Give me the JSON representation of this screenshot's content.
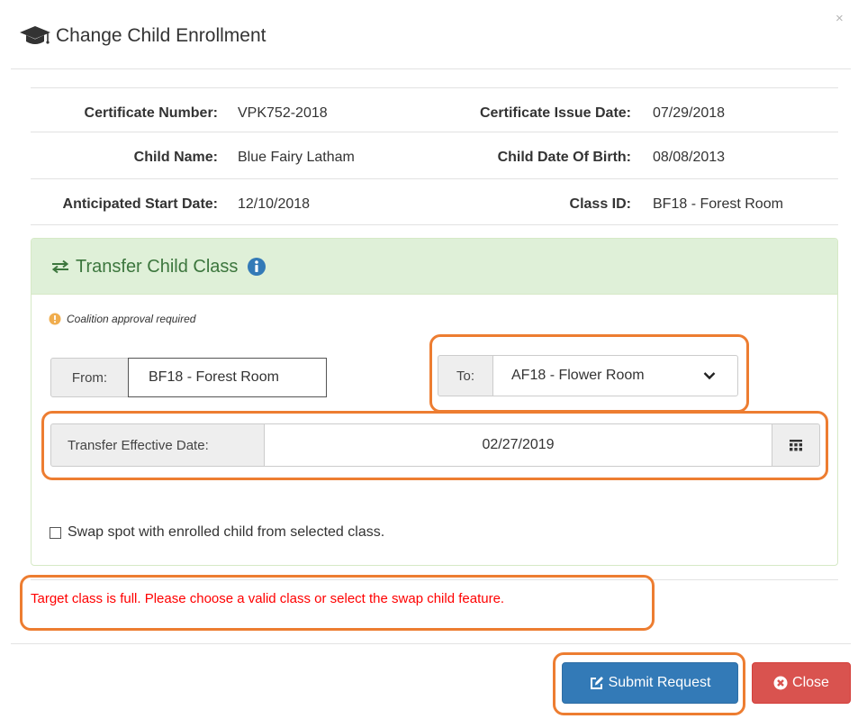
{
  "header": {
    "title": "Change Child Enrollment",
    "close_glyph": "×"
  },
  "info": {
    "certificate_number_label": "Certificate Number:",
    "certificate_number": "VPK752-2018",
    "certificate_issue_date_label": "Certificate Issue Date:",
    "certificate_issue_date": "07/29/2018",
    "child_name_label": "Child Name:",
    "child_name": "Blue Fairy Latham",
    "child_dob_label": "Child Date Of Birth:",
    "child_dob": "08/08/2013",
    "anticipated_start_label": "Anticipated Start Date:",
    "anticipated_start": "12/10/2018",
    "class_id_label": "Class ID:",
    "class_id": "BF18 - Forest Room"
  },
  "transfer": {
    "title": "Transfer Child Class",
    "note": "Coalition approval required",
    "from_label": "From:",
    "from_value": "BF18 - Forest Room",
    "to_label": "To:",
    "to_selected": "AF18 - Flower Room",
    "effective_date_label": "Transfer Effective Date:",
    "effective_date": "02/27/2019",
    "swap_label": "Swap spot with enrolled child from selected class.",
    "swap_checked": false
  },
  "error_message": "Target class is full. Please choose a valid class or select the swap child feature.",
  "footer": {
    "submit_label": "Submit Request",
    "close_label": "Close"
  },
  "icons": {
    "title_icon": "graduation-cap-icon",
    "transfer_icon": "exchange-arrows-icon",
    "info_icon": "info-circle-icon",
    "note_icon": "exclamation-circle-icon",
    "dropdown_icon": "chevron-down-icon",
    "calendar_icon": "calendar-grid-icon",
    "submit_icon": "edit-square-icon",
    "close_icon": "times-circle-icon"
  },
  "colors": {
    "panel_header_bg": "#dff0d8",
    "panel_title": "#3c763d",
    "info_icon": "#337ab7",
    "note_icon": "#f0ad4e",
    "error_text": "#ff0000",
    "highlight_border": "#ed7d31",
    "submit_bg": "#337ab7",
    "close_bg": "#d9534f"
  }
}
